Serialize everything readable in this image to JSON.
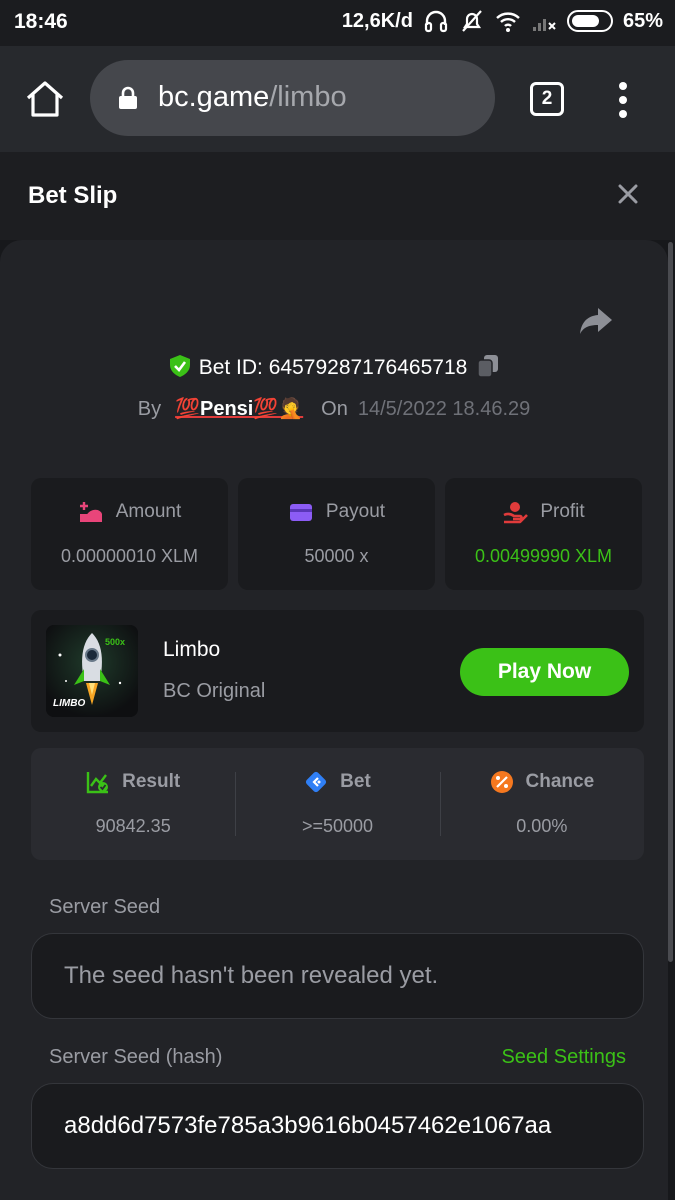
{
  "statusbar": {
    "time": "18:46",
    "speed": "12,6K/d",
    "battery": "65%"
  },
  "browser": {
    "url_host": "bc.game",
    "url_path": "/limbo",
    "tab_count": "2"
  },
  "sheet": {
    "title": "Bet Slip"
  },
  "bet": {
    "id_label": "Bet ID:",
    "id": "64579287176465718",
    "by_label": "By",
    "user": "💯Pensi💯🤦",
    "on_label": "On",
    "date": "14/5/2022 18.46.29"
  },
  "stats": {
    "amount_label": "Amount",
    "amount_value": "0.00000010 XLM",
    "payout_label": "Payout",
    "payout_value": "50000 x",
    "profit_label": "Profit",
    "profit_value": "0.00499990 XLM"
  },
  "game": {
    "name": "Limbo",
    "subtitle": "BC Original",
    "thumb_badge": "500x",
    "thumb_title": "LIMBO",
    "play_label": "Play Now"
  },
  "result": {
    "result_label": "Result",
    "result_value": "90842.35",
    "bet_label": "Bet",
    "bet_value": ">=50000",
    "chance_label": "Chance",
    "chance_value": "0.00%"
  },
  "seeds": {
    "server_seed_label": "Server Seed",
    "server_seed_value": "The seed hasn't been revealed yet.",
    "server_hash_label": "Server Seed (hash)",
    "seed_settings_label": "Seed Settings",
    "server_hash_value": "a8dd6d7573fe785a3b9616b0457462e1067aa"
  },
  "colors": {
    "accent_green": "#3bc117",
    "panel_bg": "#222327",
    "card_bg": "#1a1b1e"
  }
}
